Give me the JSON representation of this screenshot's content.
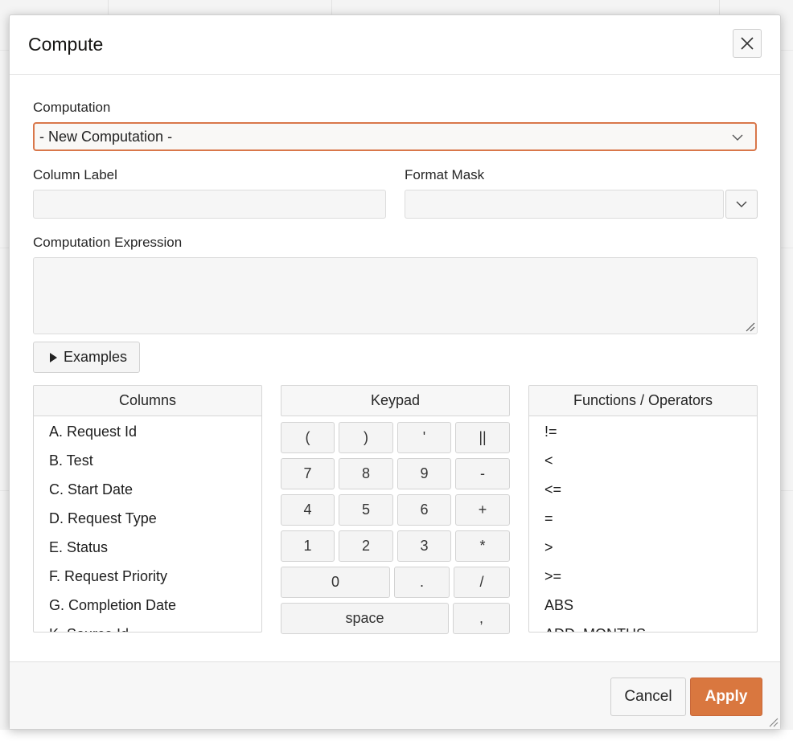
{
  "dialog": {
    "title": "Compute",
    "close_icon": "close-icon"
  },
  "form": {
    "computation_label": "Computation",
    "computation_value": "- New Computation -",
    "column_label_label": "Column Label",
    "column_label_value": "",
    "format_mask_label": "Format Mask",
    "format_mask_value": "",
    "expression_label": "Computation Expression",
    "expression_value": "",
    "examples_label": "Examples"
  },
  "columns": {
    "header": "Columns",
    "items": [
      "A. Request Id",
      "B. Test",
      "C. Start Date",
      "D. Request Type",
      "E. Status",
      "F. Request Priority",
      "G. Completion Date",
      "K. Source Id"
    ]
  },
  "keypad": {
    "header": "Keypad",
    "rows": [
      [
        "(",
        ")",
        "'",
        "||"
      ],
      [
        "7",
        "8",
        "9",
        "-"
      ],
      [
        "4",
        "5",
        "6",
        "+"
      ],
      [
        "1",
        "2",
        "3",
        "*"
      ],
      [
        "0",
        ".",
        "/"
      ],
      [
        "space",
        ","
      ]
    ]
  },
  "functions": {
    "header": "Functions / Operators",
    "items": [
      "!=",
      "<",
      "<=",
      "=",
      ">",
      ">=",
      "ABS",
      "ADD_MONTHS"
    ]
  },
  "footer": {
    "cancel_label": "Cancel",
    "apply_label": "Apply"
  },
  "colors": {
    "accent": "#d9773f",
    "focus_border": "#d9774a"
  }
}
